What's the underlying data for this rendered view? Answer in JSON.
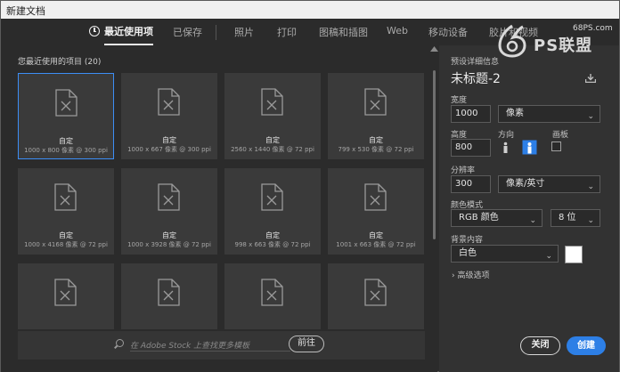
{
  "window": {
    "title": "新建文档"
  },
  "nav": {
    "items": [
      "最近使用项",
      "已保存",
      "照片",
      "打印",
      "图稿和插图",
      "Web",
      "移动设备",
      "胶片和视频"
    ],
    "active_index": 0
  },
  "recent": {
    "label": "您最近使用的项目 (20)",
    "items": [
      {
        "name": "自定",
        "meta": "1000 x 800 像素 @ 300 ppi",
        "selected": true
      },
      {
        "name": "自定",
        "meta": "1000 x 667 像素 @ 300 ppi"
      },
      {
        "name": "自定",
        "meta": "2560 x 1440 像素 @ 72 ppi"
      },
      {
        "name": "自定",
        "meta": "799 x 530 像素 @ 72 ppi"
      },
      {
        "name": "自定",
        "meta": "1000 x 4168 像素 @ 72 ppi"
      },
      {
        "name": "自定",
        "meta": "1000 x 3928 像素 @ 72 ppi"
      },
      {
        "name": "自定",
        "meta": "998 x 663 像素 @ 72 ppi"
      },
      {
        "name": "自定",
        "meta": "1001 x 663 像素 @ 72 ppi"
      },
      {
        "name": "",
        "meta": ""
      },
      {
        "name": "",
        "meta": ""
      },
      {
        "name": "",
        "meta": ""
      },
      {
        "name": "",
        "meta": ""
      }
    ]
  },
  "stock": {
    "placeholder": "在 Adobe Stock 上查找更多模板",
    "go_label": "前往"
  },
  "preset": {
    "section_label": "预设详细信息",
    "doc_name": "未标题-2",
    "width_label": "宽度",
    "width_value": "1000",
    "width_unit": "像素",
    "height_label": "高度",
    "height_value": "800",
    "orientation_label": "方向",
    "artboard_label": "画板",
    "resolution_label": "分辨率",
    "resolution_value": "300",
    "resolution_unit": "像素/英寸",
    "color_mode_label": "颜色模式",
    "color_mode_value": "RGB 颜色",
    "bit_depth_value": "8 位",
    "background_label": "背景内容",
    "background_value": "白色",
    "background_color": "#ffffff",
    "advanced_label": "高级选项",
    "close_label": "关闭",
    "create_label": "创建"
  },
  "watermark": {
    "url": "68PS.com",
    "brand": "PS联盟"
  },
  "colors": {
    "accent": "#2d7fe6",
    "selection": "#3c8ef5"
  }
}
